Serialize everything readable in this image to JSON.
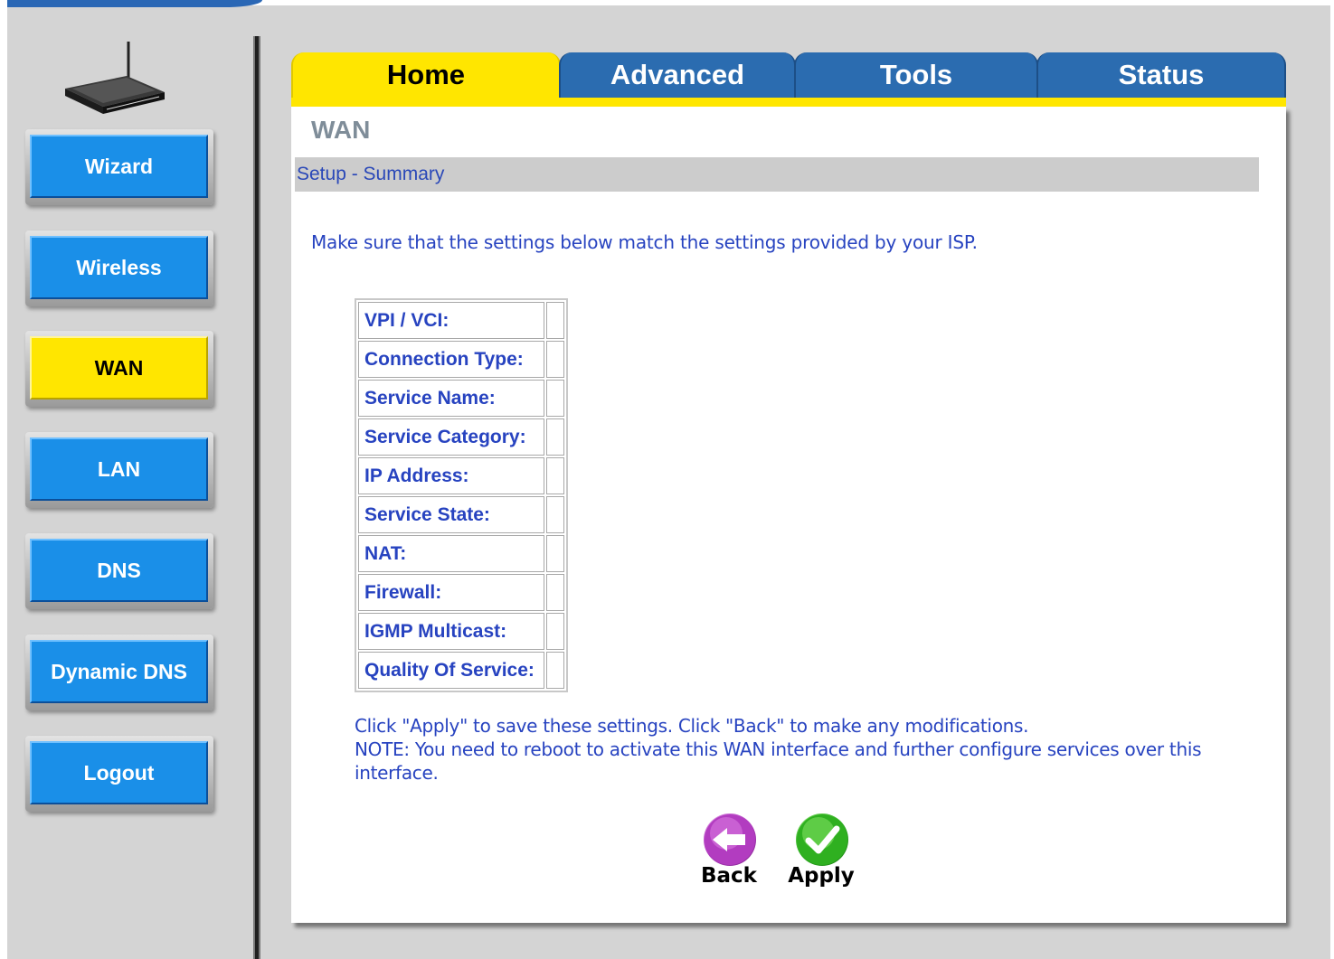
{
  "tabs": [
    {
      "label": "Home",
      "active": true
    },
    {
      "label": "Advanced",
      "active": false
    },
    {
      "label": "Tools",
      "active": false
    },
    {
      "label": "Status",
      "active": false
    }
  ],
  "sidebar": {
    "items": [
      {
        "label": "Wizard",
        "active": false
      },
      {
        "label": "Wireless",
        "active": false
      },
      {
        "label": "WAN",
        "active": true
      },
      {
        "label": "LAN",
        "active": false
      },
      {
        "label": "DNS",
        "active": false
      },
      {
        "label": "Dynamic DNS",
        "active": false
      },
      {
        "label": "Logout",
        "active": false
      }
    ]
  },
  "page": {
    "title": "WAN",
    "section": "Setup - Summary",
    "intro": "Make sure that the settings below match the settings provided by your ISP.",
    "summary": [
      {
        "label": "VPI / VCI:",
        "value": ""
      },
      {
        "label": "Connection Type:",
        "value": ""
      },
      {
        "label": "Service Name:",
        "value": ""
      },
      {
        "label": "Service Category:",
        "value": ""
      },
      {
        "label": "IP Address:",
        "value": ""
      },
      {
        "label": "Service State:",
        "value": ""
      },
      {
        "label": "NAT:",
        "value": ""
      },
      {
        "label": "Firewall:",
        "value": ""
      },
      {
        "label": "IGMP Multicast:",
        "value": ""
      },
      {
        "label": "Quality Of Service:",
        "value": ""
      }
    ],
    "note_line1": "Click \"Apply\" to save these settings. Click \"Back\" to make any modifications.",
    "note_line2": "NOTE: You need to reboot to activate this WAN interface and further configure services over this interface."
  },
  "actions": {
    "back_label": "Back",
    "apply_label": "Apply"
  },
  "colors": {
    "tab_active": "#ffe600",
    "tab_inactive": "#2b6cb0",
    "nav_button": "#1a8fe8",
    "nav_active": "#ffe600",
    "text_blue": "#2743c0",
    "title_gray": "#7f8d99"
  },
  "icons": {
    "back": "arrow-left-icon",
    "apply": "checkmark-icon",
    "router": "router-device-icon"
  }
}
